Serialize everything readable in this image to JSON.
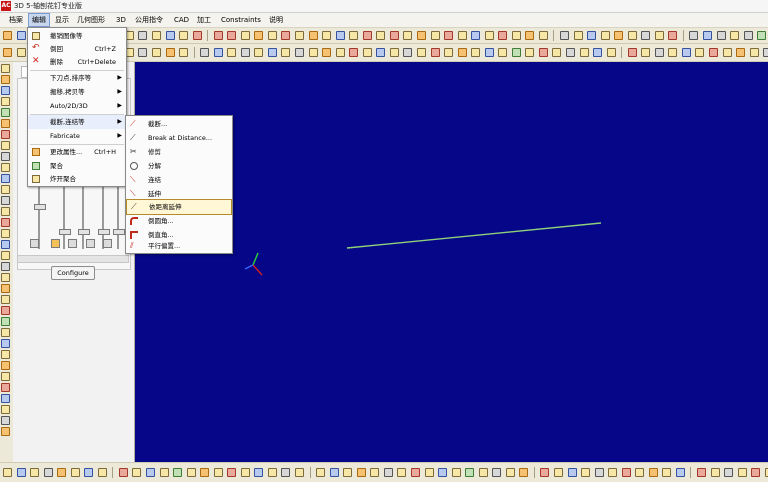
{
  "window": {
    "title": "3D 5-轴刨花钉专业版"
  },
  "app_icon": {
    "text": "AC"
  },
  "menubar": {
    "items": [
      {
        "label": "档案"
      },
      {
        "label": "编辑"
      },
      {
        "label": "显示"
      },
      {
        "label": "几何图形"
      },
      {
        "label": "3D"
      },
      {
        "label": "公用指令"
      },
      {
        "label": "CAD"
      },
      {
        "label": "加工"
      },
      {
        "label": "Constraints"
      },
      {
        "label": "说明"
      }
    ]
  },
  "edit_menu": {
    "items": [
      {
        "label": "撤销图像等",
        "shortcut": ""
      },
      {
        "label": "倒回",
        "shortcut": "Ctrl+Z"
      },
      {
        "label": "删除",
        "shortcut": "Ctrl+Delete"
      },
      {
        "label": "下刀点,排序等",
        "shortcut": ""
      },
      {
        "label": "搬移,拷贝等",
        "shortcut": ""
      },
      {
        "label": "Auto/2D/3D",
        "shortcut": ""
      },
      {
        "label": "截断,连结等",
        "shortcut": ""
      },
      {
        "label": "Fabricate",
        "shortcut": ""
      },
      {
        "label": "更改属性...",
        "shortcut": "Ctrl+H"
      },
      {
        "label": "聚合",
        "shortcut": ""
      },
      {
        "label": "炸开聚合",
        "shortcut": ""
      }
    ]
  },
  "sub_menu": {
    "items": [
      {
        "label": "截断..."
      },
      {
        "label": "Break at Distance..."
      },
      {
        "label": "修剪"
      },
      {
        "label": "分解"
      },
      {
        "label": "连结"
      },
      {
        "label": "延伸"
      },
      {
        "label": "依距离延伸"
      },
      {
        "label": "倒圆角..."
      },
      {
        "label": "倒直角..."
      },
      {
        "label": "平行偏置..."
      }
    ]
  },
  "side_panel": {
    "configure_label": "Configure"
  },
  "colors": {
    "canvas_background": "#050688",
    "geometry_line": "#8fd17a",
    "axis_x": "#d42020",
    "axis_y": "#2ad43a",
    "axis_z": "#3a66ff"
  }
}
